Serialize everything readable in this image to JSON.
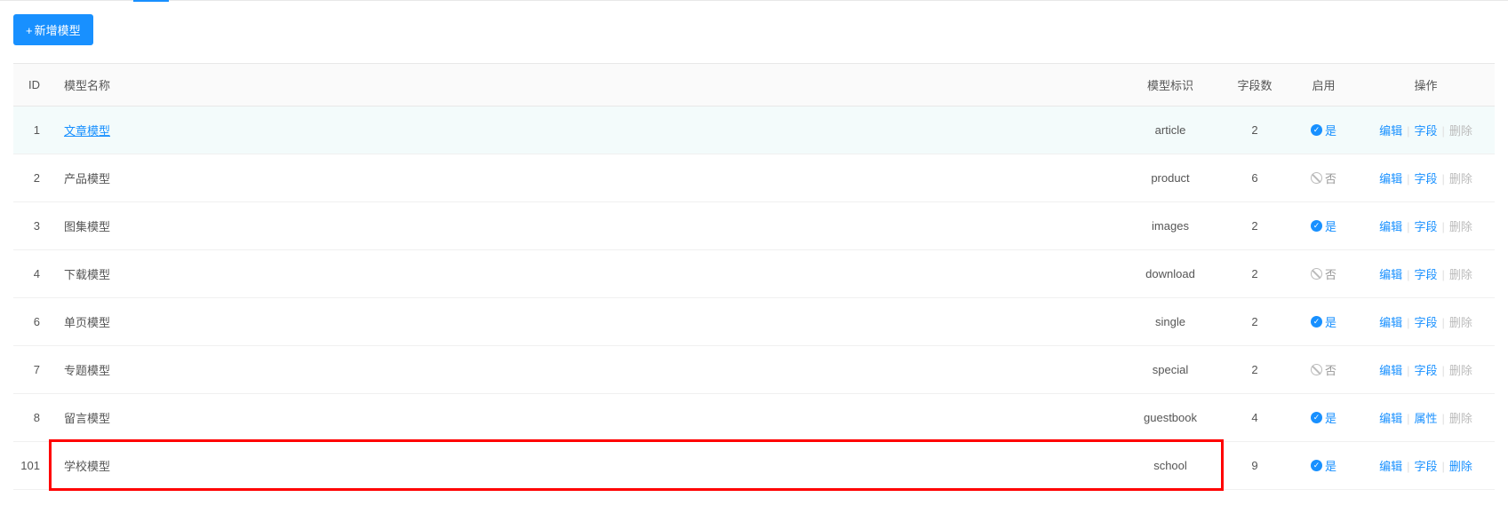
{
  "buttons": {
    "add": "新增模型"
  },
  "table": {
    "headers": {
      "id": "ID",
      "name": "模型名称",
      "ident": "模型标识",
      "fields": "字段数",
      "enabled": "启用",
      "actions": "操作"
    },
    "enabled_labels": {
      "yes": "是",
      "no": "否"
    },
    "action_labels": {
      "edit": "编辑",
      "fields": "字段",
      "attrs": "属性",
      "delete": "删除"
    },
    "rows": [
      {
        "id": "1",
        "name": "文章模型",
        "ident": "article",
        "fields": "2",
        "enabled": true,
        "highlighted": true,
        "name_link": true,
        "secondary_action": "fields",
        "delete_enabled": false
      },
      {
        "id": "2",
        "name": "产品模型",
        "ident": "product",
        "fields": "6",
        "enabled": false,
        "secondary_action": "fields",
        "delete_enabled": false
      },
      {
        "id": "3",
        "name": "图集模型",
        "ident": "images",
        "fields": "2",
        "enabled": true,
        "secondary_action": "fields",
        "delete_enabled": false
      },
      {
        "id": "4",
        "name": "下载模型",
        "ident": "download",
        "fields": "2",
        "enabled": false,
        "secondary_action": "fields",
        "delete_enabled": false
      },
      {
        "id": "6",
        "name": "单页模型",
        "ident": "single",
        "fields": "2",
        "enabled": true,
        "secondary_action": "fields",
        "delete_enabled": false
      },
      {
        "id": "7",
        "name": "专题模型",
        "ident": "special",
        "fields": "2",
        "enabled": false,
        "secondary_action": "fields",
        "delete_enabled": false
      },
      {
        "id": "8",
        "name": "留言模型",
        "ident": "guestbook",
        "fields": "4",
        "enabled": true,
        "secondary_action": "attrs",
        "delete_enabled": false
      },
      {
        "id": "101",
        "name": "学校模型",
        "ident": "school",
        "fields": "9",
        "enabled": true,
        "secondary_action": "fields",
        "delete_enabled": true,
        "red_box": true
      }
    ]
  }
}
